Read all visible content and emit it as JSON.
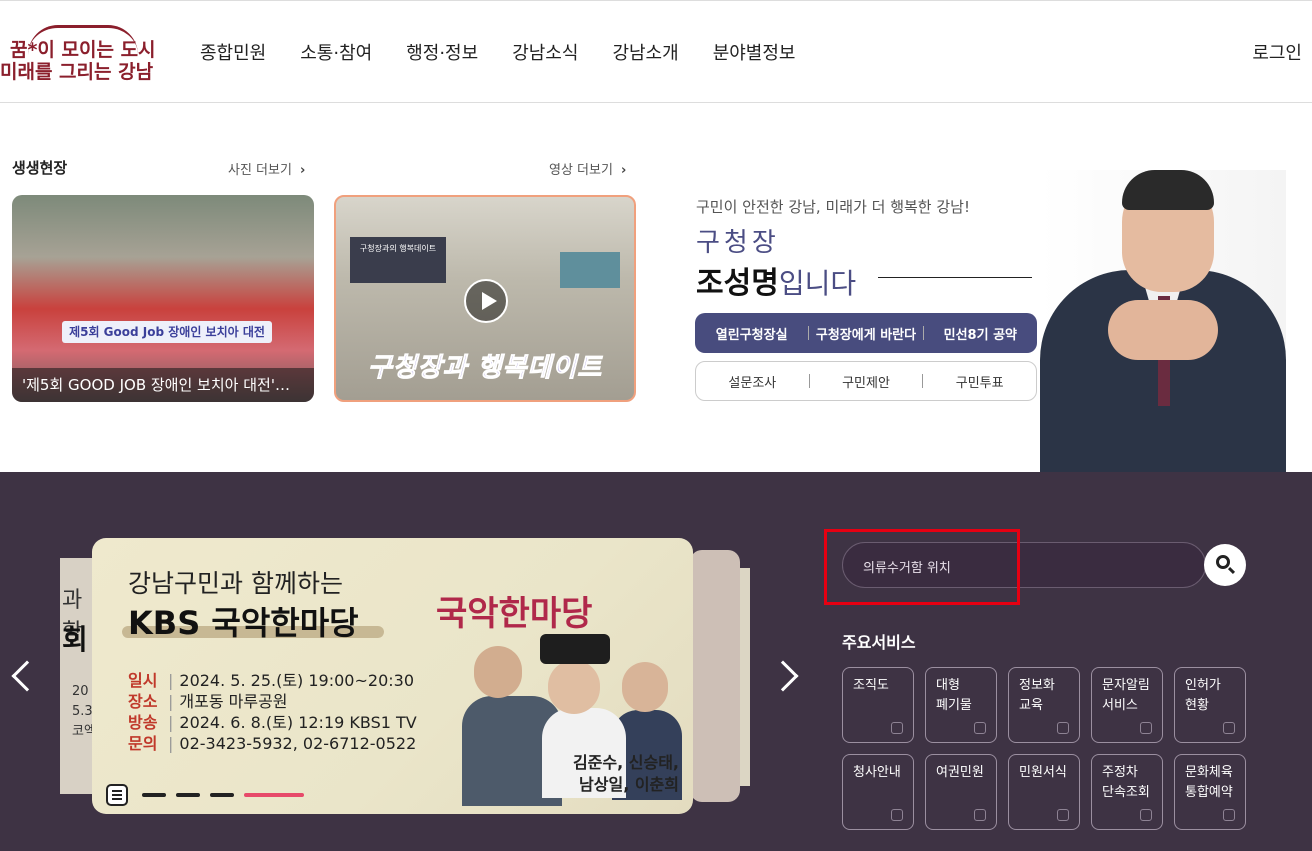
{
  "header": {
    "logo_line1": "꿈*이 모이는 도시",
    "logo_line2": "미래를 그리는 강남",
    "nav": [
      "종합민원",
      "소통·참여",
      "행정·정보",
      "강남소식",
      "강남소개",
      "분야별정보"
    ],
    "login": "로그인"
  },
  "news": {
    "section_title": "생생현장",
    "photo_more": "사진 더보기",
    "video_more": "영상 더보기",
    "photo_caption": "'제5회 GOOD JOB 장애인 보치아 대전'…",
    "photo_banner": "제5회 Good Job 장애인 보치아 대전",
    "video_screen": "구청장과의 행복데이트",
    "video_title": "구청장과 행복데이트"
  },
  "mayor": {
    "slogan": "구민이 안전한 강남, 미래가 더 행복한 강남!",
    "role": "구청장",
    "name": "조성명",
    "name_suffix": "입니다",
    "primary_links": [
      "열린구청장실",
      "구청장에게 바란다",
      "민선8기 공약"
    ],
    "secondary_links": [
      "설문조사",
      "구민제안",
      "구민투표"
    ]
  },
  "slider": {
    "subtitle": "강남구민과 함께하는",
    "title": "KBS 국악한마당",
    "logo_text": "국악한마당",
    "rows": [
      {
        "key": "일시",
        "value": "2024. 5. 25.(토) 19:00~20:30"
      },
      {
        "key": "장소",
        "value": "개포동 마루공원"
      },
      {
        "key": "방송",
        "value": "2024. 6. 8.(토) 12:19 KBS1 TV"
      },
      {
        "key": "문의",
        "value": "02-3423-5932, 02-6712-0522"
      }
    ],
    "names_line1": "김준수, 신승태,",
    "names_line2": "남상일, 이춘희",
    "back_left_title1": "과 함",
    "back_left_title2": "회",
    "back_left_lines": [
      "20",
      "5.3",
      "코엑"
    ],
    "dot_count": 4,
    "active_dot": 3
  },
  "search": {
    "value": "의류수거함 위치",
    "button_icon": "search-icon"
  },
  "services": {
    "title": "주요서비스",
    "items": [
      {
        "label": "조직도",
        "icon": "person-icon"
      },
      {
        "label": "대형\n폐기물",
        "icon": "folder-icon"
      },
      {
        "label": "정보화\n교육",
        "icon": "globe-icon"
      },
      {
        "label": "문자알림\n서비스",
        "icon": "document-icon"
      },
      {
        "label": "인허가\n현황",
        "icon": "stamp-icon"
      },
      {
        "label": "청사안내",
        "icon": "flag-icon"
      },
      {
        "label": "여권민원",
        "icon": "passport-icon"
      },
      {
        "label": "민원서식",
        "icon": "form-icon"
      },
      {
        "label": "주정차\n단속조회",
        "icon": "car-icon"
      },
      {
        "label": "문화체육\n통합예약",
        "icon": "signal-icon"
      }
    ]
  },
  "colors": {
    "brand": "#8b1f2c",
    "mayor_pill": "#484c7e",
    "bottom_bg": "#3e3344",
    "active_dot": "#e74a6a",
    "highlight": "#e60012"
  }
}
